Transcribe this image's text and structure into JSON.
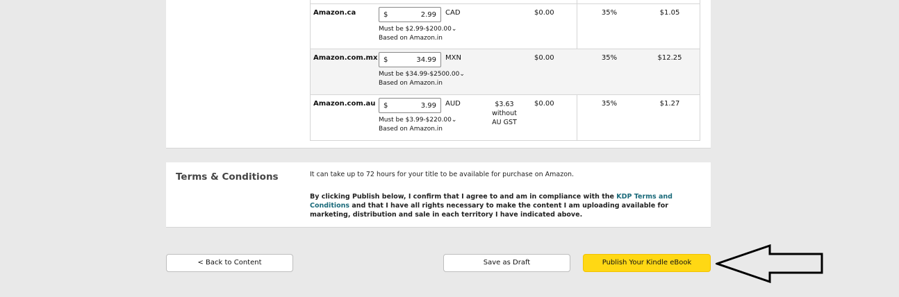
{
  "pricing": {
    "rows": [
      {
        "market": "Amazon.ca",
        "currency_symbol": "$",
        "price": "2.99",
        "currency": "CAD",
        "range": "Must be $2.99-$200.00",
        "based_on": "Based on Amazon.in",
        "tax": "",
        "delivery": "$0.00",
        "rate": "35%",
        "royalty": "$1.05"
      },
      {
        "market": "Amazon.com.mx",
        "currency_symbol": "$",
        "price": "34.99",
        "currency": "MXN",
        "range": "Must be $34.99-$2500.00",
        "based_on": "Based on Amazon.in",
        "tax": "",
        "delivery": "$0.00",
        "rate": "35%",
        "royalty": "$12.25"
      },
      {
        "market": "Amazon.com.au",
        "currency_symbol": "$",
        "price": "3.99",
        "currency": "AUD",
        "range": "Must be $3.99-$220.00",
        "based_on": "Based on Amazon.in",
        "tax": "$3.63 without AU GST",
        "delivery": "$0.00",
        "rate": "35%",
        "royalty": "$1.27"
      }
    ]
  },
  "terms": {
    "title": "Terms & Conditions",
    "note": "It can take up to 72 hours for your title to be available for purchase on Amazon.",
    "agree_before": "By clicking Publish below, I confirm that I agree to and am in compliance with the ",
    "agree_link": "KDP Terms and Conditions",
    "agree_after": " and that I have all rights necessary to make the content I am uploading available for marketing, distribution and sale in each territory I have indicated above."
  },
  "actions": {
    "back_label": "< Back to Content",
    "draft_label": "Save as Draft",
    "publish_label": "Publish Your Kindle eBook"
  },
  "annotation": {
    "arrow_icon": "left-arrow-outline-icon",
    "arrow_color": "#000000"
  },
  "colors": {
    "publish": "#ffd814",
    "link": "#1a6a7a",
    "background": "#e9e9e9"
  }
}
